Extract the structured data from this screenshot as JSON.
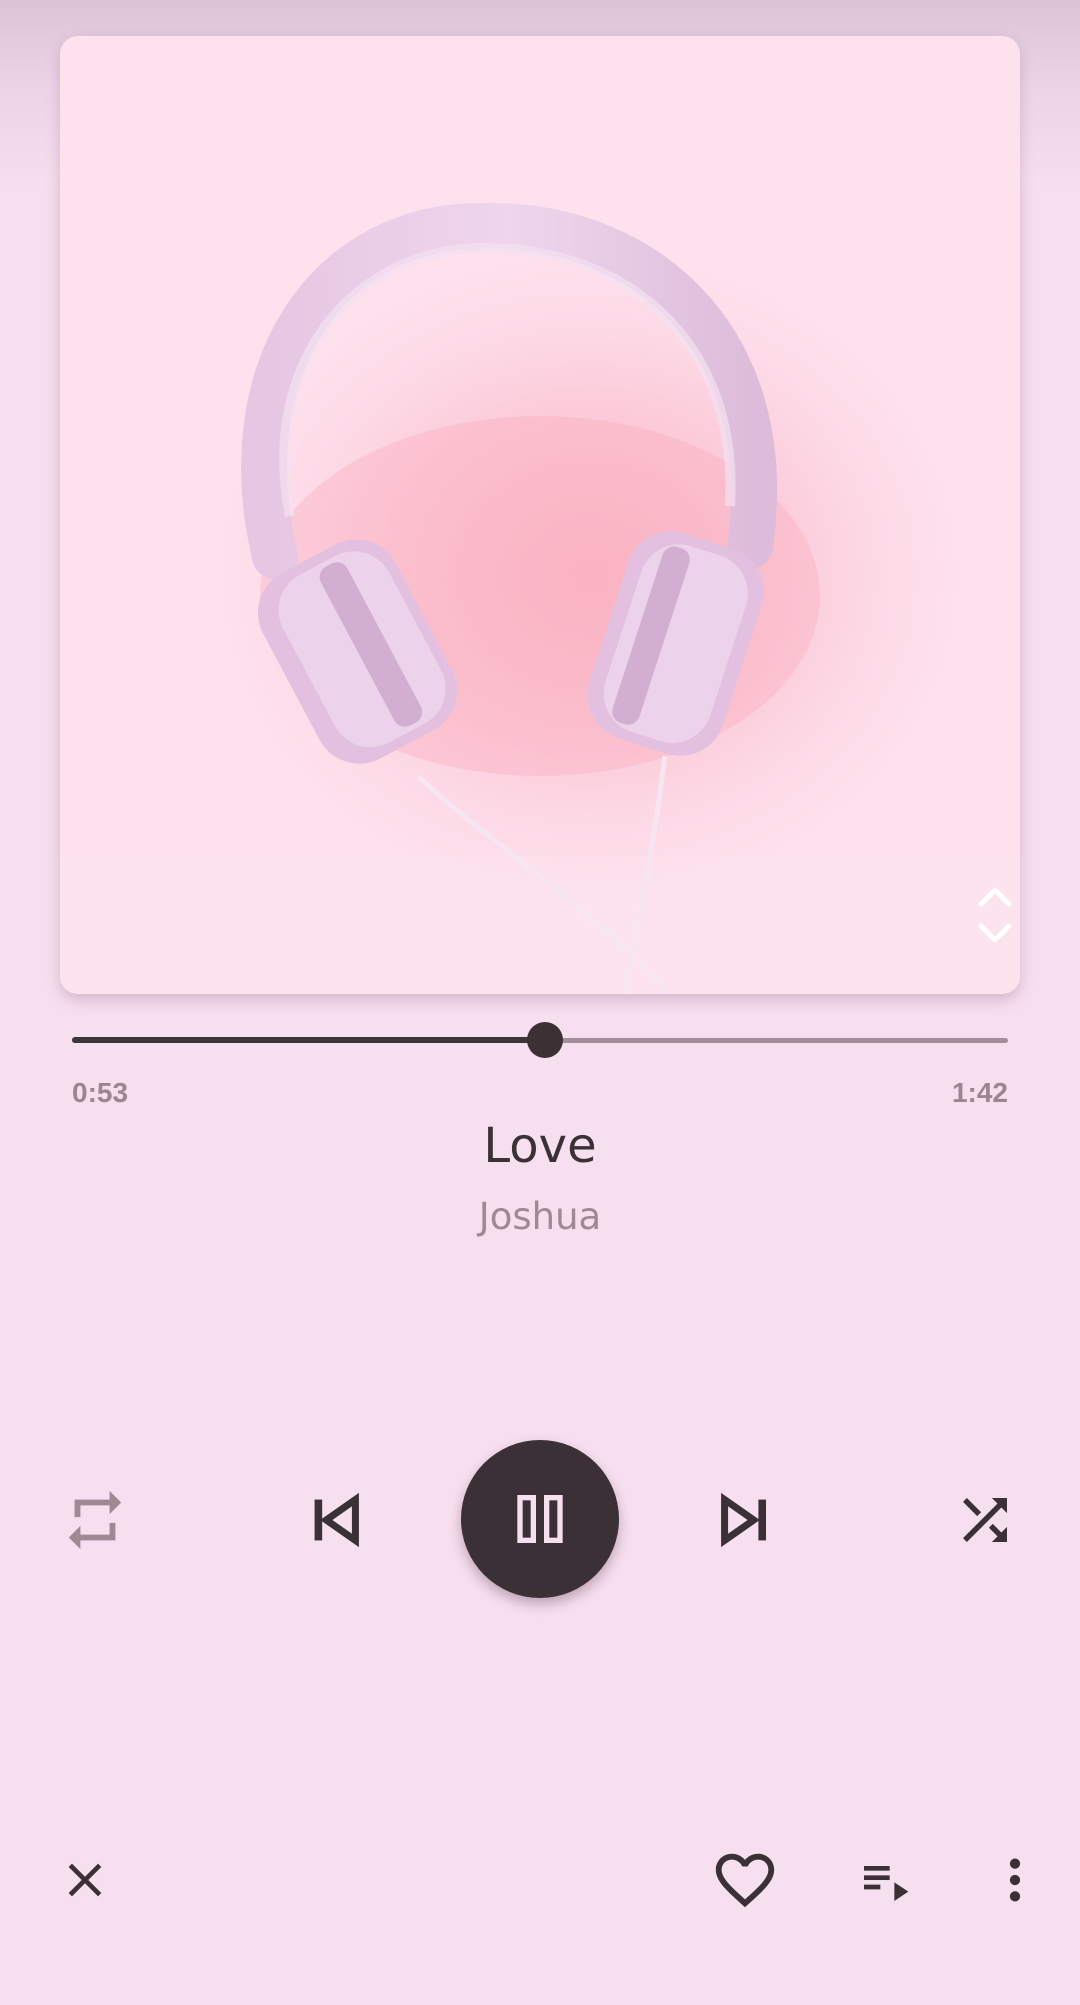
{
  "player": {
    "elapsed": "0:53",
    "total": "1:42",
    "progress": 0.505
  },
  "track": {
    "title": "Love",
    "artist": "Joshua"
  },
  "icons": {
    "expand": "unfold-icon",
    "repeat": "repeat-icon",
    "previous": "skip-previous-icon",
    "pause": "pause-icon",
    "next": "skip-next-icon",
    "shuffle": "shuffle-icon",
    "close": "close-icon",
    "favorite": "heart-icon",
    "queue": "queue-icon",
    "more": "more-vert-icon"
  },
  "colors": {
    "background": "#f6dfef",
    "accent": "#3a3035",
    "secondary_text": "#9e8995"
  }
}
